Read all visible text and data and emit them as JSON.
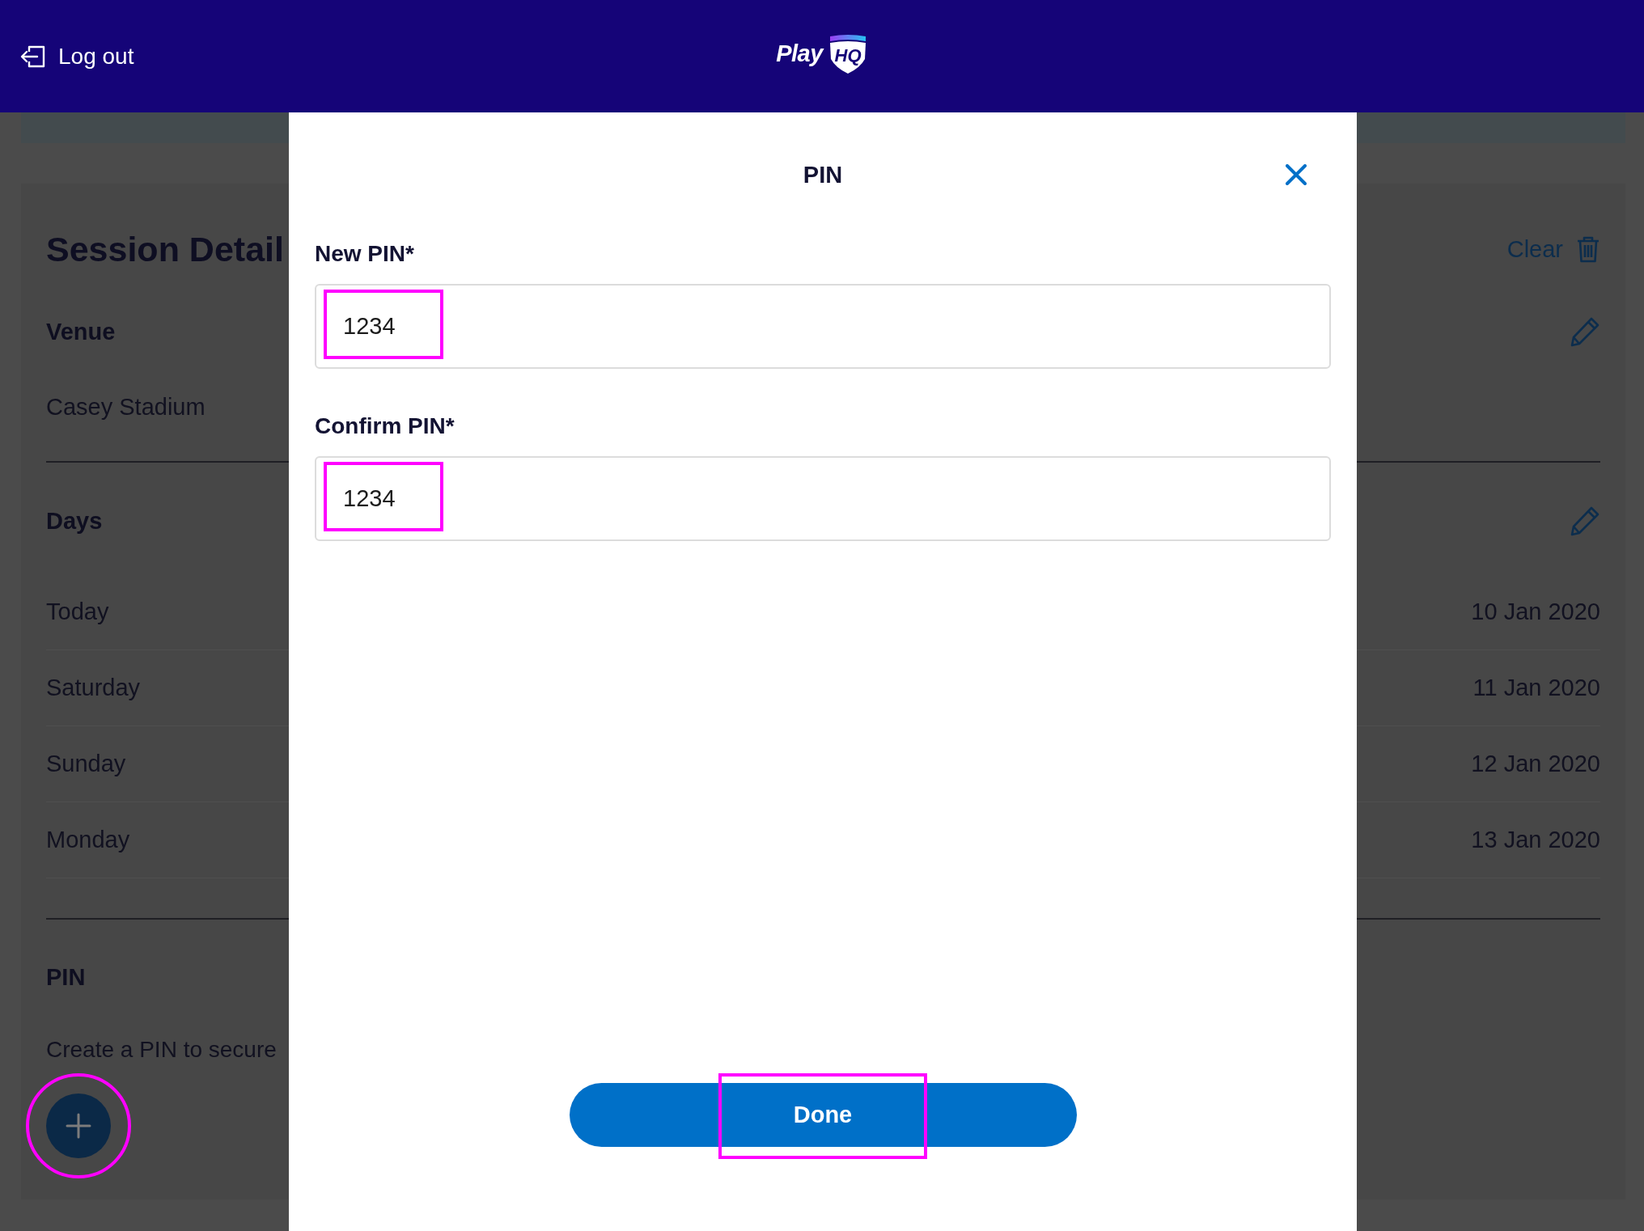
{
  "header": {
    "logout_label": "Log out",
    "logo": {
      "text": "Play",
      "badge": "HQ"
    }
  },
  "session": {
    "title": "Session Detail",
    "clear_label": "Clear",
    "venue": {
      "heading": "Venue",
      "value": "Casey Stadium"
    },
    "days": {
      "heading": "Days",
      "rows": [
        {
          "day": "Today",
          "date": "10 Jan 2020"
        },
        {
          "day": "Saturday",
          "date": "11 Jan 2020"
        },
        {
          "day": "Sunday",
          "date": "12 Jan 2020"
        },
        {
          "day": "Monday",
          "date": "13 Jan 2020"
        }
      ]
    },
    "pin": {
      "heading": "PIN",
      "description": "Create a PIN to secure"
    },
    "add_button": {
      "highlighted": true
    }
  },
  "modal": {
    "title": "PIN",
    "fields": [
      {
        "label": "New PIN*",
        "value": "1234",
        "highlighted": true
      },
      {
        "label": "Confirm PIN*",
        "value": "1234",
        "highlighted": true
      }
    ],
    "done_button": {
      "label": "Done",
      "highlighted": true
    }
  }
}
